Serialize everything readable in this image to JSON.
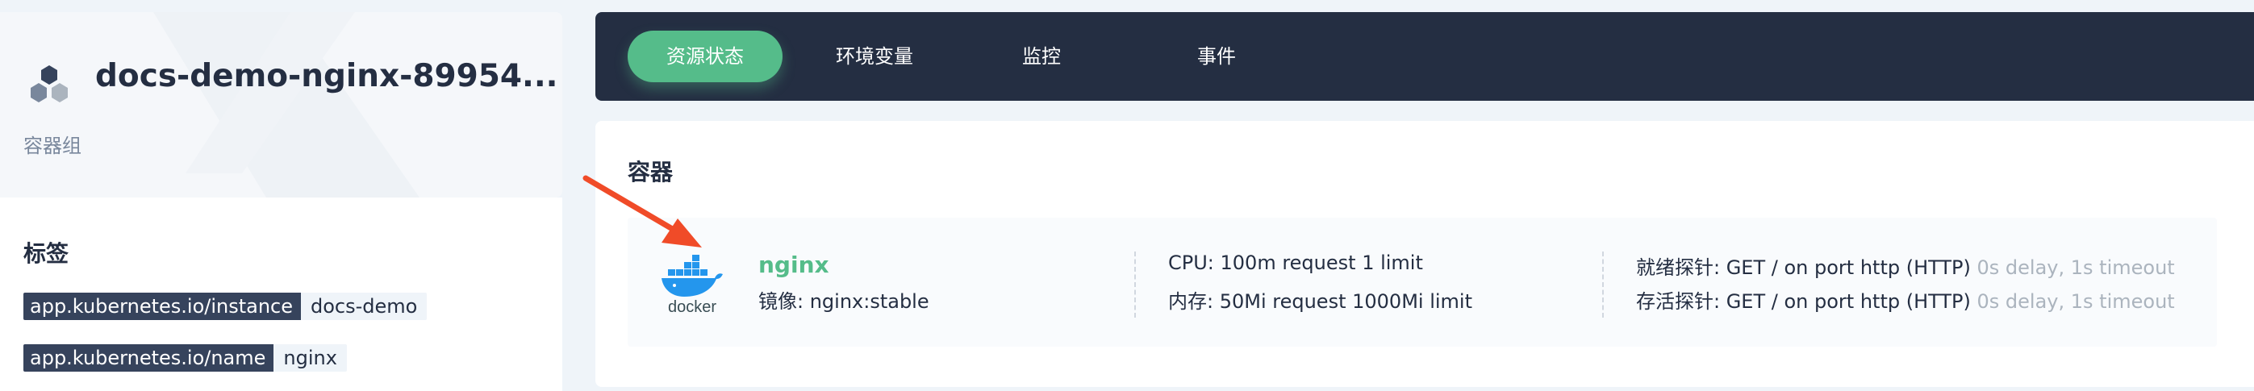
{
  "hero": {
    "title": "docs-demo-nginx-89954...",
    "subtitle": "容器组"
  },
  "labels": {
    "title": "标签",
    "items": [
      {
        "key": "app.kubernetes.io/instance",
        "value": "docs-demo"
      },
      {
        "key": "app.kubernetes.io/name",
        "value": "nginx"
      }
    ]
  },
  "tabs": [
    {
      "label": "资源状态",
      "active": true
    },
    {
      "label": "环境变量",
      "active": false
    },
    {
      "label": "监控",
      "active": false
    },
    {
      "label": "事件",
      "active": false
    }
  ],
  "containers": {
    "title": "容器",
    "items": [
      {
        "logo_text": "docker",
        "name": "nginx",
        "image": "镜像: nginx:stable",
        "cpu": "CPU: 100m request 1 limit",
        "memory": "内存: 50Mi request 1000Mi limit",
        "readiness_main": "就绪探针: GET / on port http (HTTP)",
        "readiness_detail": "0s delay, 1s timeout",
        "liveness_main": "存活探针: GET / on port http (HTTP)",
        "liveness_detail": "0s delay, 1s timeout"
      }
    ]
  },
  "colors": {
    "accent_green": "#55bc8a",
    "dark_bar": "#242e42",
    "arrow_red": "#f04b28",
    "docker_blue": "#2496ed"
  },
  "icons": [
    "pod-cubes-icon",
    "docker-logo-icon",
    "annotation-arrow-icon"
  ]
}
